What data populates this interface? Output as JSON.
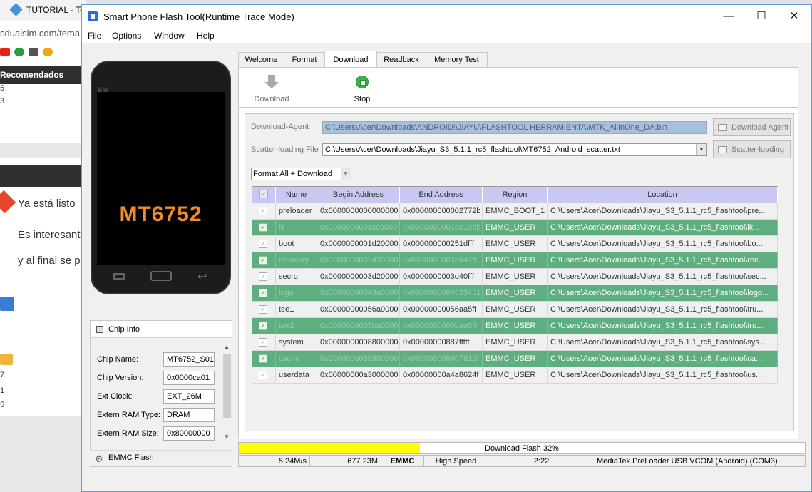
{
  "browser": {
    "tab_title": "TUTORIAL - To",
    "address": "sdualsim.com/tema",
    "section_title": "Recomendados",
    "list_numbers": [
      "5",
      "3"
    ],
    "text_lines": [
      "Ya está listo",
      "Es interesant",
      "y al final se p"
    ],
    "side_numbers": [
      "7",
      "1",
      "5"
    ]
  },
  "window": {
    "title": "Smart Phone Flash Tool(Runtime Trace Mode)",
    "minimize": "—",
    "maximize": "☐",
    "close": "✕"
  },
  "menu": [
    "File",
    "Options",
    "Window",
    "Help"
  ],
  "phone": {
    "brand": "BM",
    "label": "MT6752"
  },
  "chip_info": {
    "title": "Chip Info",
    "fields": [
      {
        "label": "Chip Name:",
        "value": "MT6752_S01"
      },
      {
        "label": "Chip Version:",
        "value": "0x0000ca01"
      },
      {
        "label": "Ext Clock:",
        "value": "EXT_26M"
      },
      {
        "label": "Extern RAM Type:",
        "value": "DRAM"
      },
      {
        "label": "Extern RAM Size:",
        "value": "0x80000000"
      }
    ],
    "emmc_flash": "EMMC Flash"
  },
  "tabs": [
    "Welcome",
    "Format",
    "Download",
    "Readback",
    "Memory Test"
  ],
  "active_tab": "Download",
  "toolbar": {
    "download": "Download",
    "stop": "Stop"
  },
  "download": {
    "agent_label": "Download-Agent",
    "agent_path": "C:\\Users\\Acer\\Downloads\\ANDROID!\\JIAYU\\FLASHTOOL HERRAMIENTA\\MTK_AllInOne_DA.bin",
    "agent_button": "Download Agent",
    "scatter_label": "Scatter-loading File",
    "scatter_path": "C:\\Users\\Acer\\Downloads\\Jiayu_S3_5.1.1_rc5_flashtool\\MT6752_Android_scatter.txt",
    "scatter_button": "Scatter-loading",
    "mode": "Format All + Download"
  },
  "table": {
    "columns": [
      "",
      "Name",
      "Begin Address",
      "End Address",
      "Region",
      "Location"
    ],
    "rows": [
      {
        "name": "preloader",
        "begin": "0x0000000000000000",
        "end": "0x000000000002772b",
        "region": "EMMC_BOOT_1",
        "location": "C:\\Users\\Acer\\Downloads\\Jiayu_S3_5.1.1_rc5_flashtool\\pre..."
      },
      {
        "name": "lk",
        "begin": "0x0000000001cc0000",
        "end": "0x0000000001d010db",
        "region": "EMMC_USER",
        "location": "C:\\Users\\Acer\\Downloads\\Jiayu_S3_5.1.1_rc5_flashtool\\lk..."
      },
      {
        "name": "boot",
        "begin": "0x0000000001d20000",
        "end": "0x000000000251dfff",
        "region": "EMMC_USER",
        "location": "C:\\Users\\Acer\\Downloads\\Jiayu_S3_5.1.1_rc5_flashtool\\bo..."
      },
      {
        "name": "recovery",
        "begin": "0x0000000002d20000",
        "end": "0x0000000003a647ff",
        "region": "EMMC_USER",
        "location": "C:\\Users\\Acer\\Downloads\\Jiayu_S3_5.1.1_rc5_flashtool\\rec..."
      },
      {
        "name": "secro",
        "begin": "0x0000000003d20000",
        "end": "0x0000000003d40fff",
        "region": "EMMC_USER",
        "location": "C:\\Users\\Acer\\Downloads\\Jiayu_S3_5.1.1_rc5_flashtool\\sec..."
      },
      {
        "name": "logo",
        "begin": "0x00000000043a0000",
        "end": "0x0000000004523451",
        "region": "EMMC_USER",
        "location": "C:\\Users\\Acer\\Downloads\\Jiayu_S3_5.1.1_rc5_flashtool\\logo..."
      },
      {
        "name": "tee1",
        "begin": "0x00000000056a0000",
        "end": "0x00000000056aa5ff",
        "region": "EMMC_USER",
        "location": "C:\\Users\\Acer\\Downloads\\Jiayu_S3_5.1.1_rc5_flashtool\\tru..."
      },
      {
        "name": "tee2",
        "begin": "0x0000000005ba0000",
        "end": "0x0000000005baa5ff",
        "region": "EMMC_USER",
        "location": "C:\\Users\\Acer\\Downloads\\Jiayu_S3_5.1.1_rc5_flashtool\\tru..."
      },
      {
        "name": "system",
        "begin": "0x0000000008800000",
        "end": "0x00000000887fffff",
        "region": "EMMC_USER",
        "location": "C:\\Users\\Acer\\Downloads\\Jiayu_S3_5.1.1_rc5_flashtool\\sys..."
      },
      {
        "name": "cache",
        "begin": "0x0000000088800000",
        "end": "0x000000008907812f",
        "region": "EMMC_USER",
        "location": "C:\\Users\\Acer\\Downloads\\Jiayu_S3_5.1.1_rc5_flashtool\\ca..."
      },
      {
        "name": "userdata",
        "begin": "0x00000000a3000000",
        "end": "0x00000000a4a8624f",
        "region": "EMMC_USER",
        "location": "C:\\Users\\Acer\\Downloads\\Jiayu_S3_5.1.1_rc5_flashtool\\us..."
      }
    ]
  },
  "progress": {
    "label": "Download Flash 32%",
    "fraction": 0.32,
    "color": "#ffff00"
  },
  "status": {
    "speed": "5.24M/s",
    "size": "677.23M",
    "storage": "EMMC",
    "usb_speed": "High Speed",
    "time": "2:22",
    "port": "MediaTek PreLoader USB VCOM (Android) (COM3)"
  },
  "colors": {
    "accent": "#5fae80",
    "header": "#c8c8f0",
    "agent_field": "#a7c0dc",
    "phone_label": "#f08c28"
  }
}
